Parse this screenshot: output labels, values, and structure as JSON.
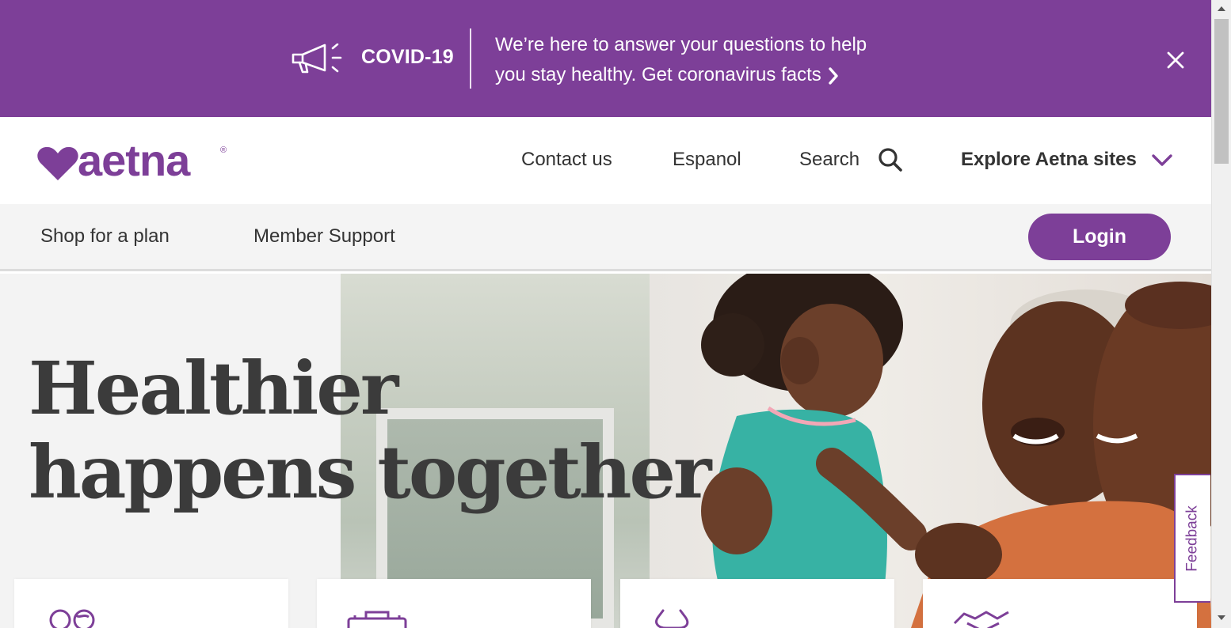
{
  "banner": {
    "label": "COVID-19",
    "message_line1": "We’re here to answer your questions to help",
    "message_line2": "you stay healthy. Get coronavirus facts",
    "background": "#7d3f98"
  },
  "brand": {
    "name": "aetna",
    "color": "#7d3f98"
  },
  "header": {
    "contact": "Contact us",
    "espanol": "Espanol",
    "search": "Search",
    "explore": "Explore Aetna sites"
  },
  "subnav": {
    "shop": "Shop for a plan",
    "member": "Member Support",
    "login": "Login"
  },
  "hero": {
    "title_line1": "Healthier",
    "title_line2": "happens together"
  },
  "cards": [
    {
      "icon": "people-icon"
    },
    {
      "icon": "briefcase-icon"
    },
    {
      "icon": "stethoscope-icon"
    },
    {
      "icon": "handshake-icon"
    }
  ],
  "feedback": "Feedback"
}
